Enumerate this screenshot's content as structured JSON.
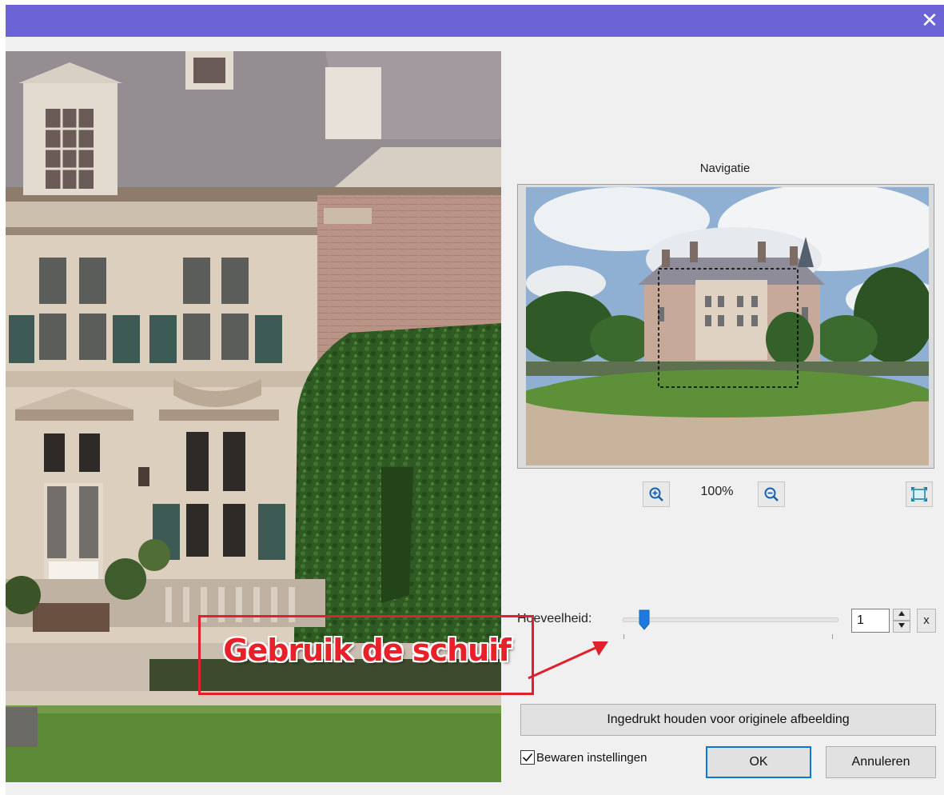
{
  "window": {
    "close_symbol": "✕"
  },
  "navigation": {
    "title": "Navigatie",
    "zoom_level": "100%"
  },
  "icons": {
    "close": "close-icon",
    "zoom_in": "zoom-in-icon",
    "zoom_out": "zoom-out-icon",
    "fit": "fit-to-window-icon",
    "spin_up": "arrow-up-icon",
    "spin_down": "arrow-down-icon",
    "check": "checkmark-icon",
    "callout_arrow": "arrow-icon"
  },
  "amount": {
    "label": "Hoeveelheid:",
    "value": "1",
    "clear_label": "x",
    "slider_fraction": 0.1
  },
  "controls": {
    "hold_original_label": "Ingedrukt houden voor originele afbeelding",
    "save_settings_label": "Bewaren instellingen",
    "save_settings_checked": true,
    "ok_label": "OK",
    "cancel_label": "Annuleren"
  },
  "annotation": {
    "callout_text": "Gebruik de schuif"
  },
  "colors": {
    "titlebar": "#6b63d6",
    "accent": "#0a78d7",
    "callout": "#e0212b",
    "dialog_bg": "#f0f0f0"
  }
}
